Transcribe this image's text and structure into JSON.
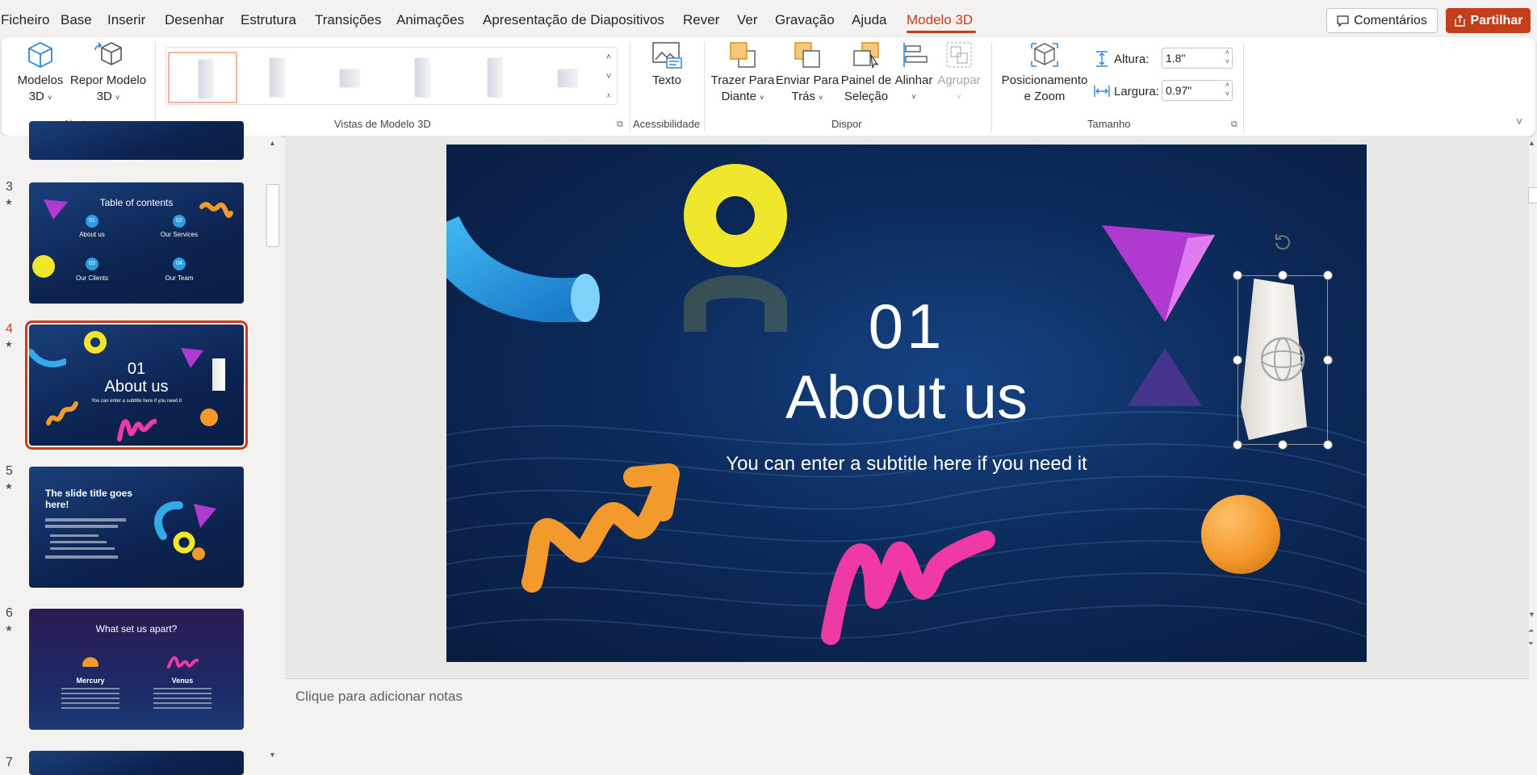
{
  "menu": {
    "items": [
      "Ficheiro",
      "Base",
      "Inserir",
      "Desenhar",
      "Estrutura",
      "Transições",
      "Animações",
      "Apresentação de Diapositivos",
      "Rever",
      "Ver",
      "Gravação",
      "Ajuda",
      "Modelo 3D"
    ],
    "active": "Modelo 3D"
  },
  "header": {
    "comments_label": "Comentários",
    "share_label": "Partilhar",
    "accent": "#c43e1c"
  },
  "ribbon": {
    "models_label": "Modelos",
    "models_sub": "3D",
    "reset_label": "Repor Modelo",
    "reset_sub": "3D",
    "adjust_group": "Ajustar",
    "views_group": "Vistas de Modelo 3D",
    "alt_text_label": "Texto",
    "accessibility_group": "Acessibilidade",
    "bring_forward": "Trazer Para",
    "bring_forward_sub": "Diante",
    "send_backward": "Enviar Para",
    "send_backward_sub": "Trás",
    "selection_pane": "Painel de",
    "selection_pane_sub": "Seleção",
    "align": "Alinhar",
    "group": "Agrupar",
    "arrange_group": "Dispor",
    "pan_zoom": "Posicionamento",
    "pan_zoom_sub": "e Zoom",
    "height_label": "Altura:",
    "height_value": "1.8\"",
    "width_label": "Largura:",
    "width_value": "0.97\"",
    "size_group": "Tamanho"
  },
  "slides": {
    "s3": {
      "num": "3",
      "title": "Table of contents",
      "items": [
        {
          "n": "01",
          "label": "About us"
        },
        {
          "n": "02",
          "label": "Our Services"
        },
        {
          "n": "03",
          "label": "Our Clients"
        },
        {
          "n": "04",
          "label": "Our Team"
        }
      ]
    },
    "s4": {
      "num": "4",
      "number": "01",
      "title": "About us",
      "subtitle": "You can enter a subtitle here if you need it"
    },
    "s5": {
      "num": "5",
      "title": "The slide title goes here!"
    },
    "s6": {
      "num": "6",
      "title": "What set us apart?",
      "left": "Mercury",
      "right": "Venus"
    },
    "s7": {
      "num": "7"
    }
  },
  "main_slide": {
    "number": "01",
    "title": "About us",
    "subtitle": "You can enter a subtitle here if you need it"
  },
  "notes": {
    "placeholder": "Clique para adicionar notas"
  }
}
